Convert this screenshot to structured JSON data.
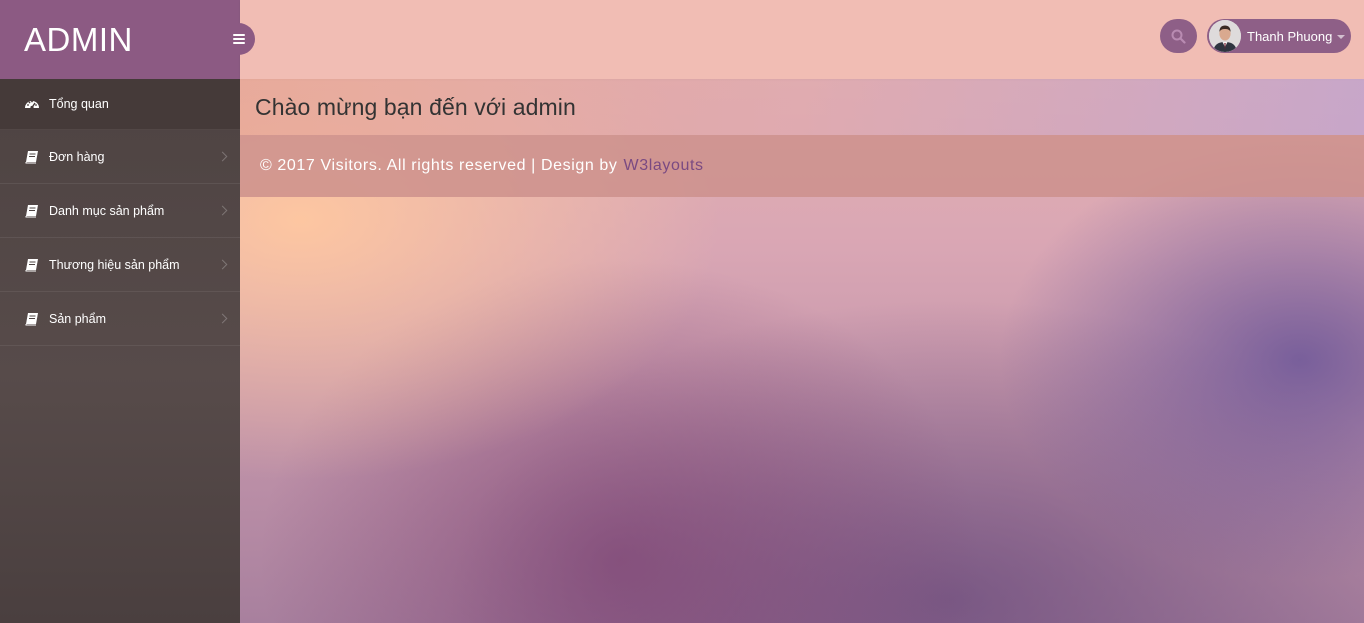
{
  "sidebar": {
    "brand": "ADMIN",
    "items": [
      {
        "label": "Tổng quan",
        "icon": "dashboard-icon",
        "active": true
      },
      {
        "label": "Đơn hàng",
        "icon": "book-icon"
      },
      {
        "label": "Danh mục sản phẩm",
        "icon": "book-icon"
      },
      {
        "label": "Thương hiệu sản phẩm",
        "icon": "book-icon"
      },
      {
        "label": "Sản phẩm",
        "icon": "book-icon"
      }
    ]
  },
  "header": {
    "user_name": "Thanh Phuong",
    "search_icon": "search-icon",
    "menu_icon": "bars-icon"
  },
  "main": {
    "welcome": "Chào mừng bạn đến với admin"
  },
  "footer": {
    "text": "© 2017 Visitors. All rights reserved | Design by",
    "link_text": "W3layouts"
  },
  "colors": {
    "brand": "#8c5a83",
    "header": "#f1bdb4",
    "sidebar": "#4b4140",
    "link": "#7a4a82"
  }
}
